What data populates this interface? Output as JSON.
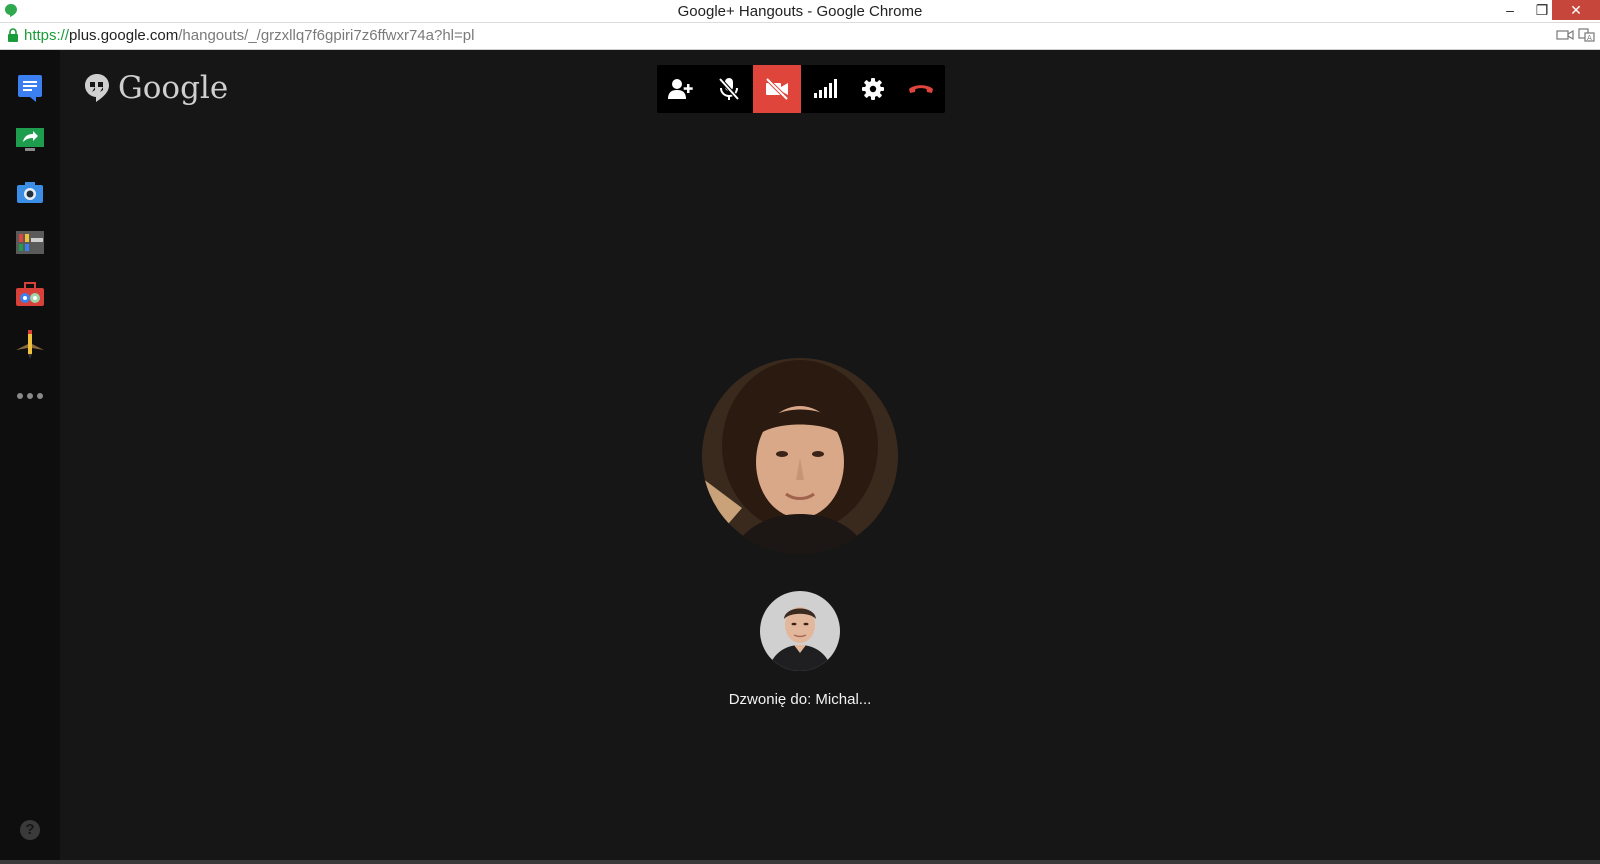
{
  "window": {
    "title": "Google+ Hangouts - Google Chrome",
    "controls": {
      "minimize": "–",
      "maximize": "❐",
      "close": "✕"
    }
  },
  "address": {
    "scheme": "https://",
    "host": "plus.google.com",
    "path": "/hangouts/_/grzxllq7f6gpiri7z6ffwxr74a?hl=pl"
  },
  "sidebar": {
    "items": [
      {
        "name": "chat",
        "icon": "chat-icon"
      },
      {
        "name": "screen-share",
        "icon": "screen-share-icon"
      },
      {
        "name": "camera",
        "icon": "camera-icon"
      },
      {
        "name": "control-room",
        "icon": "control-room-icon"
      },
      {
        "name": "effects",
        "icon": "toolbox-icon"
      },
      {
        "name": "cacoo",
        "icon": "pencil-icon"
      },
      {
        "name": "more",
        "icon": "more-icon"
      }
    ],
    "help_label": "?"
  },
  "brand": {
    "logo_text": "Google"
  },
  "toolbar": {
    "buttons": [
      {
        "name": "invite",
        "icon": "add-person-icon",
        "active": false
      },
      {
        "name": "mute-mic",
        "icon": "mic-off-icon",
        "active": false
      },
      {
        "name": "camera-off",
        "icon": "video-off-icon",
        "active": true
      },
      {
        "name": "bandwidth",
        "icon": "signal-icon",
        "active": false
      },
      {
        "name": "settings",
        "icon": "gear-icon",
        "active": false
      },
      {
        "name": "hang-up",
        "icon": "phone-hangup-icon",
        "active": false
      }
    ]
  },
  "call": {
    "status_text": "Dzwonię do: Michal..."
  },
  "colors": {
    "background": "#161616",
    "sidebar": "#0e0e0e",
    "toolbar": "#000000",
    "active_button": "#e0453b",
    "hangup_red": "#e0453b",
    "url_green": "#1b9c3a"
  }
}
